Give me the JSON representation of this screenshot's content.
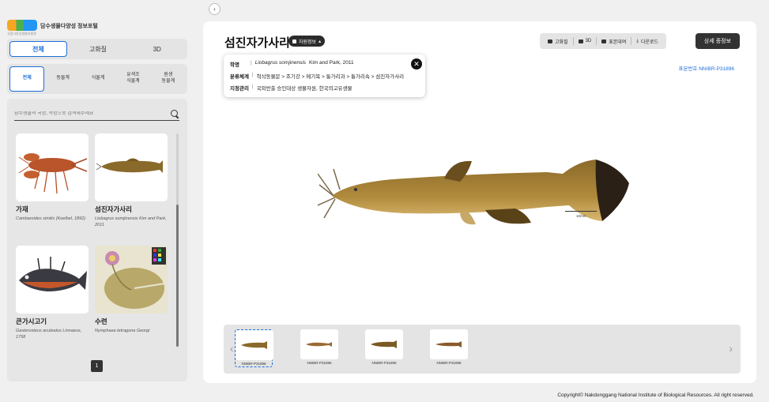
{
  "brand": {
    "title": "담수생물다양성 정보포털",
    "subtitle": "국립낙동강생물자원관"
  },
  "view_modes": [
    "전체",
    "고화질",
    "3D"
  ],
  "categories": [
    "전체",
    "동물계",
    "식물계",
    "유색조\n식물계",
    "원생\n동물계"
  ],
  "search": {
    "placeholder": "담수생물의 국명, 학명으로 검색해주세요"
  },
  "species_list": [
    {
      "name": "가재",
      "sci": "Cambaroides similis (Koelbel, 1892)"
    },
    {
      "name": "섬진자가사리",
      "sci": "Liobagrus somjinensis Kim and Park, 2011"
    },
    {
      "name": "큰가시고기",
      "sci": "Gasterosteus aculeatus Linnaeus, 1758"
    },
    {
      "name": "수련",
      "sci": "Nymphaea tetragona Georgi"
    }
  ],
  "pagination": {
    "current": "1"
  },
  "detail": {
    "title": "섬진자가사리",
    "info_toggle": "자원정보",
    "toolbar": [
      "고화질",
      "3D",
      "표본대여",
      "다운로드"
    ],
    "detail_button": "상세 종정보",
    "info": {
      "name_key": "학명",
      "name_sci": "Liobagrus somjinensis",
      "name_author": "Kim and Park, 2011",
      "class_key": "분류체계",
      "class_val": "척삭동물문 > 조기강 > 메기목 > 퉁가리과 > 퉁가리속 > 섬진자가사리",
      "status_key": "지정관리",
      "status_val": "국외반출 승인대상 생물자원, 한국의고유생물"
    },
    "specimen_no": "표본번호 NNIBR-P31896",
    "scale_label": "10mm",
    "thumbnails": [
      "NNIBR-P31896",
      "NNIBR-P31896",
      "NNIBR-P31896",
      "NNIBR-P31896"
    ]
  },
  "footer": "Copyright© Nakdonggang National Institute of Biological Resources. All right reserved."
}
